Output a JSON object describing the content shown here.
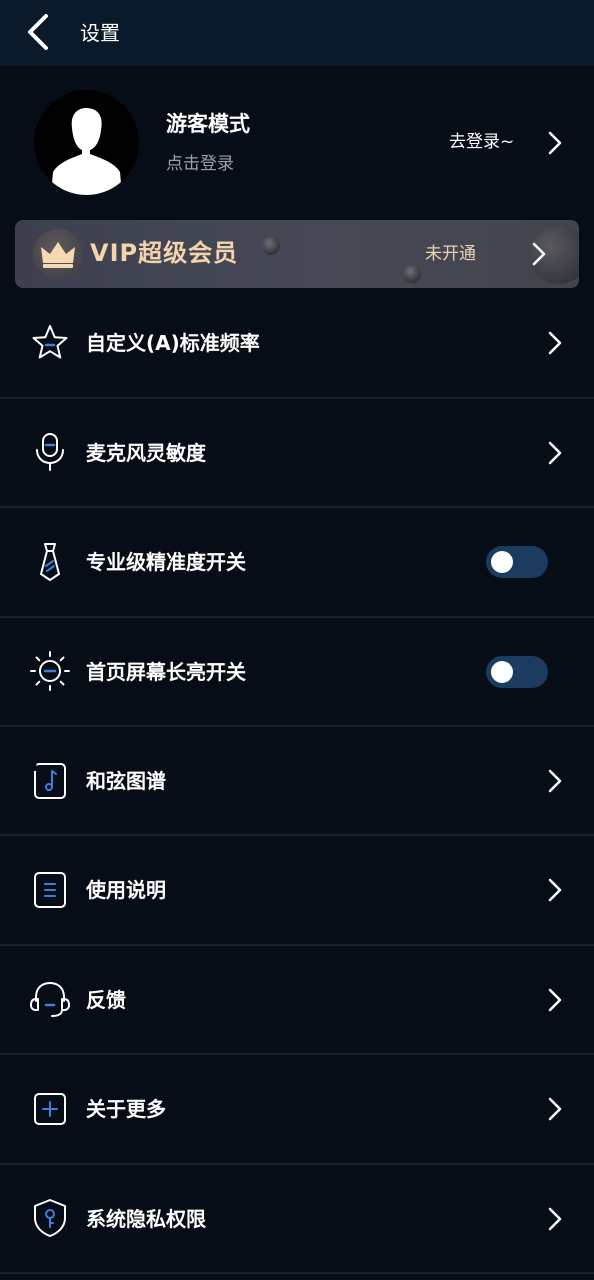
{
  "header": {
    "title": "设置",
    "back_icon": "chevron-left-icon"
  },
  "profile": {
    "name": "游客模式",
    "subtitle": "点击登录",
    "login_action": "去登录~",
    "avatar_icon": "person-silhouette-icon"
  },
  "vip": {
    "title": "VIP超级会员",
    "status": "未开通",
    "icon": "crown-icon",
    "accent_color": "#f4d3ad"
  },
  "menu": [
    {
      "label": "自定义(A)标准频率",
      "icon": "star-icon",
      "control": "arrow"
    },
    {
      "label": "麦克风灵敏度",
      "icon": "microphone-icon",
      "control": "arrow"
    },
    {
      "label": "专业级精准度开关",
      "icon": "tie-icon",
      "control": "toggle",
      "toggle_on": false
    },
    {
      "label": "首页屏幕长亮开关",
      "icon": "sun-brightness-icon",
      "control": "toggle",
      "toggle_on": false
    },
    {
      "label": "和弦图谱",
      "icon": "music-note-icon",
      "control": "arrow"
    },
    {
      "label": "使用说明",
      "icon": "document-icon",
      "control": "arrow"
    },
    {
      "label": "反馈",
      "icon": "headset-icon",
      "control": "arrow"
    },
    {
      "label": "关于更多",
      "icon": "plus-square-icon",
      "control": "arrow"
    },
    {
      "label": "系统隐私权限",
      "icon": "shield-key-icon",
      "control": "arrow"
    }
  ],
  "colors": {
    "background": "#060d17",
    "header": "#0a1a2b",
    "accent_blue": "#3d7fdc",
    "toggle_track": "#1b3b60"
  }
}
